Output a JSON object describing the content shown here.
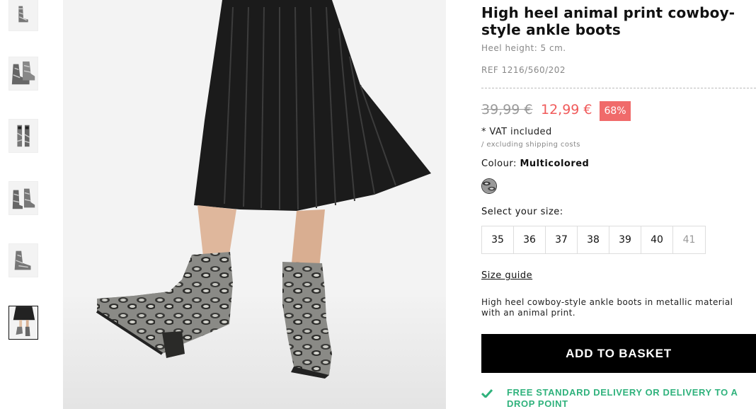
{
  "product": {
    "title": "High heel animal print cowboy-style ankle boots",
    "heel_height": "Heel height: 5 cm.",
    "ref": "REF 1216/560/202",
    "old_price": "39,99 €",
    "new_price": "12,99 €",
    "discount": "68%",
    "vat": "* VAT included",
    "shipping_note": "/ excluding shipping costs",
    "colour_label": "Colour:",
    "colour_value": "Multicolored",
    "size_label": "Select your size:",
    "sizes": [
      "35",
      "36",
      "37",
      "38",
      "39",
      "40",
      "41"
    ],
    "size_guide": "Size guide",
    "description": "High heel cowboy-style ankle boots in metallic material with an animal print.",
    "add_to_basket": "ADD TO BASKET",
    "delivery": "FREE STANDARD DELIVERY OR DELIVERY TO A DROP POINT"
  },
  "gallery": {
    "thumbnails": [
      "thumb-1",
      "thumb-2",
      "thumb-3",
      "thumb-4",
      "thumb-5",
      "thumb-6"
    ],
    "active_thumbnail": "thumb-6"
  },
  "colors": {
    "price_sale": "#f05a5a",
    "discount_badge": "#f06a6a",
    "delivery_green": "#2fb27c",
    "button_bg": "#000000"
  },
  "icons": {
    "delivery": "check-icon"
  }
}
